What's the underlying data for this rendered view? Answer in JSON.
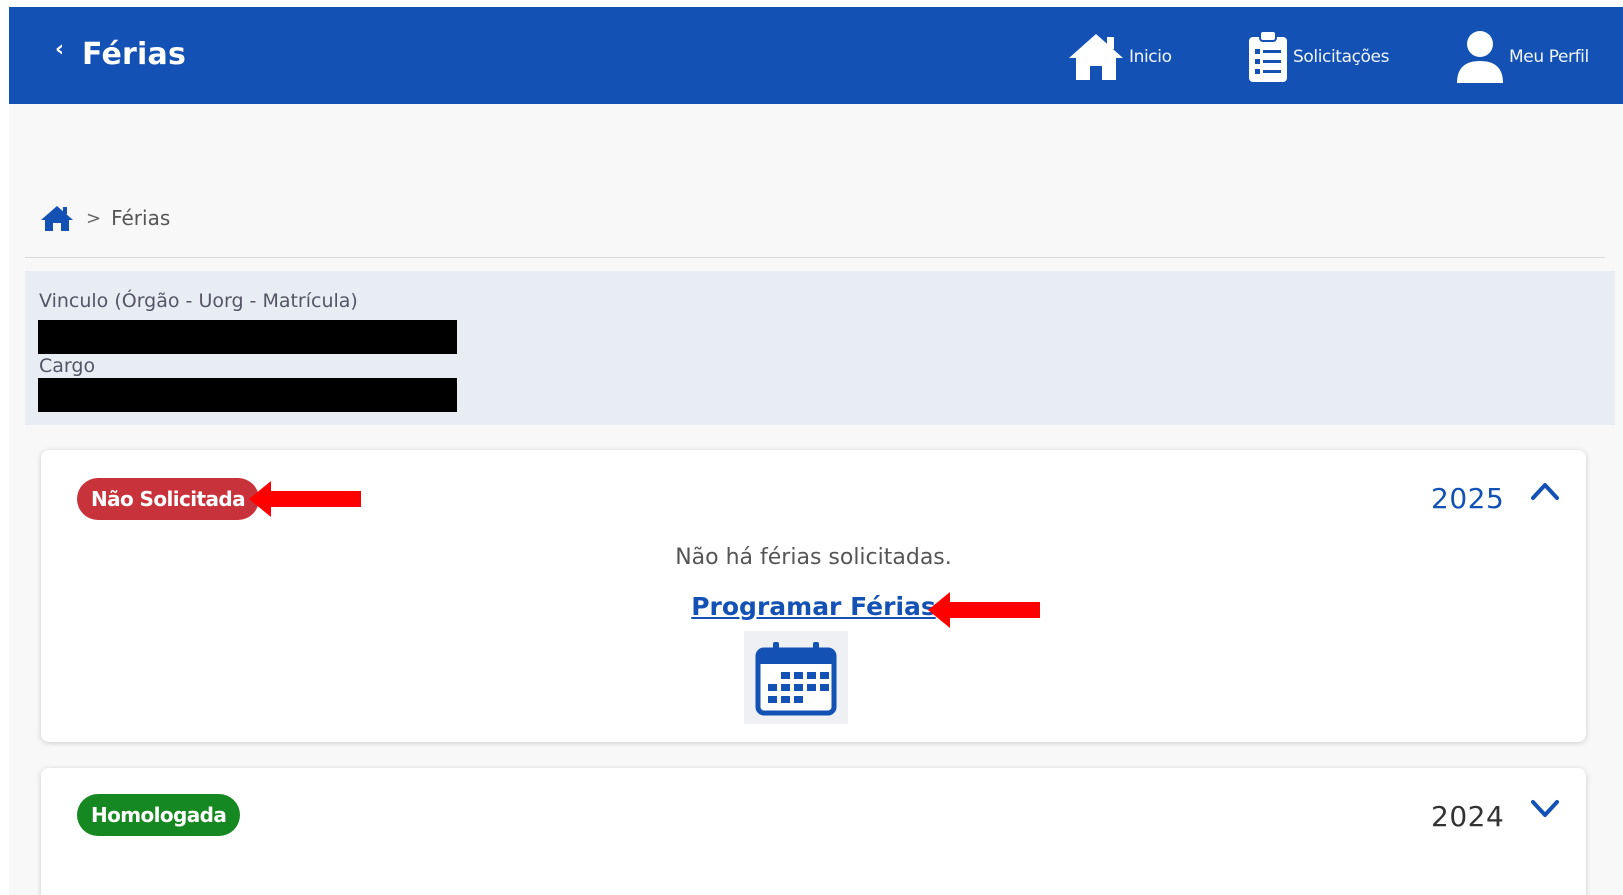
{
  "header": {
    "back_chevron": "‹",
    "title": "Férias",
    "nav": [
      {
        "label": "Inicio",
        "icon": "home-icon"
      },
      {
        "label": "Solicitações",
        "icon": "clipboard-list-icon"
      },
      {
        "label": "Meu Perfil",
        "icon": "user-icon"
      }
    ]
  },
  "breadcrumb": {
    "home_icon": "home-icon",
    "separator": ">",
    "current": "Férias"
  },
  "info": {
    "vinculo_label": "Vinculo (Órgão - Uorg - Matrícula)",
    "cargo_label": "Cargo"
  },
  "cards": [
    {
      "status": "Não Solicitada",
      "status_color": "#c8323b",
      "year": "2025",
      "expanded": true,
      "message": "Não há férias solicitadas.",
      "action_label": "Programar Férias",
      "action_icon": "calendar-icon"
    },
    {
      "status": "Homologada",
      "status_color": "#168821",
      "year": "2024",
      "expanded": false
    }
  ],
  "colors": {
    "header_bg": "#1351b4",
    "accent": "#1351b4",
    "annotation_arrow": "#ff0000"
  }
}
